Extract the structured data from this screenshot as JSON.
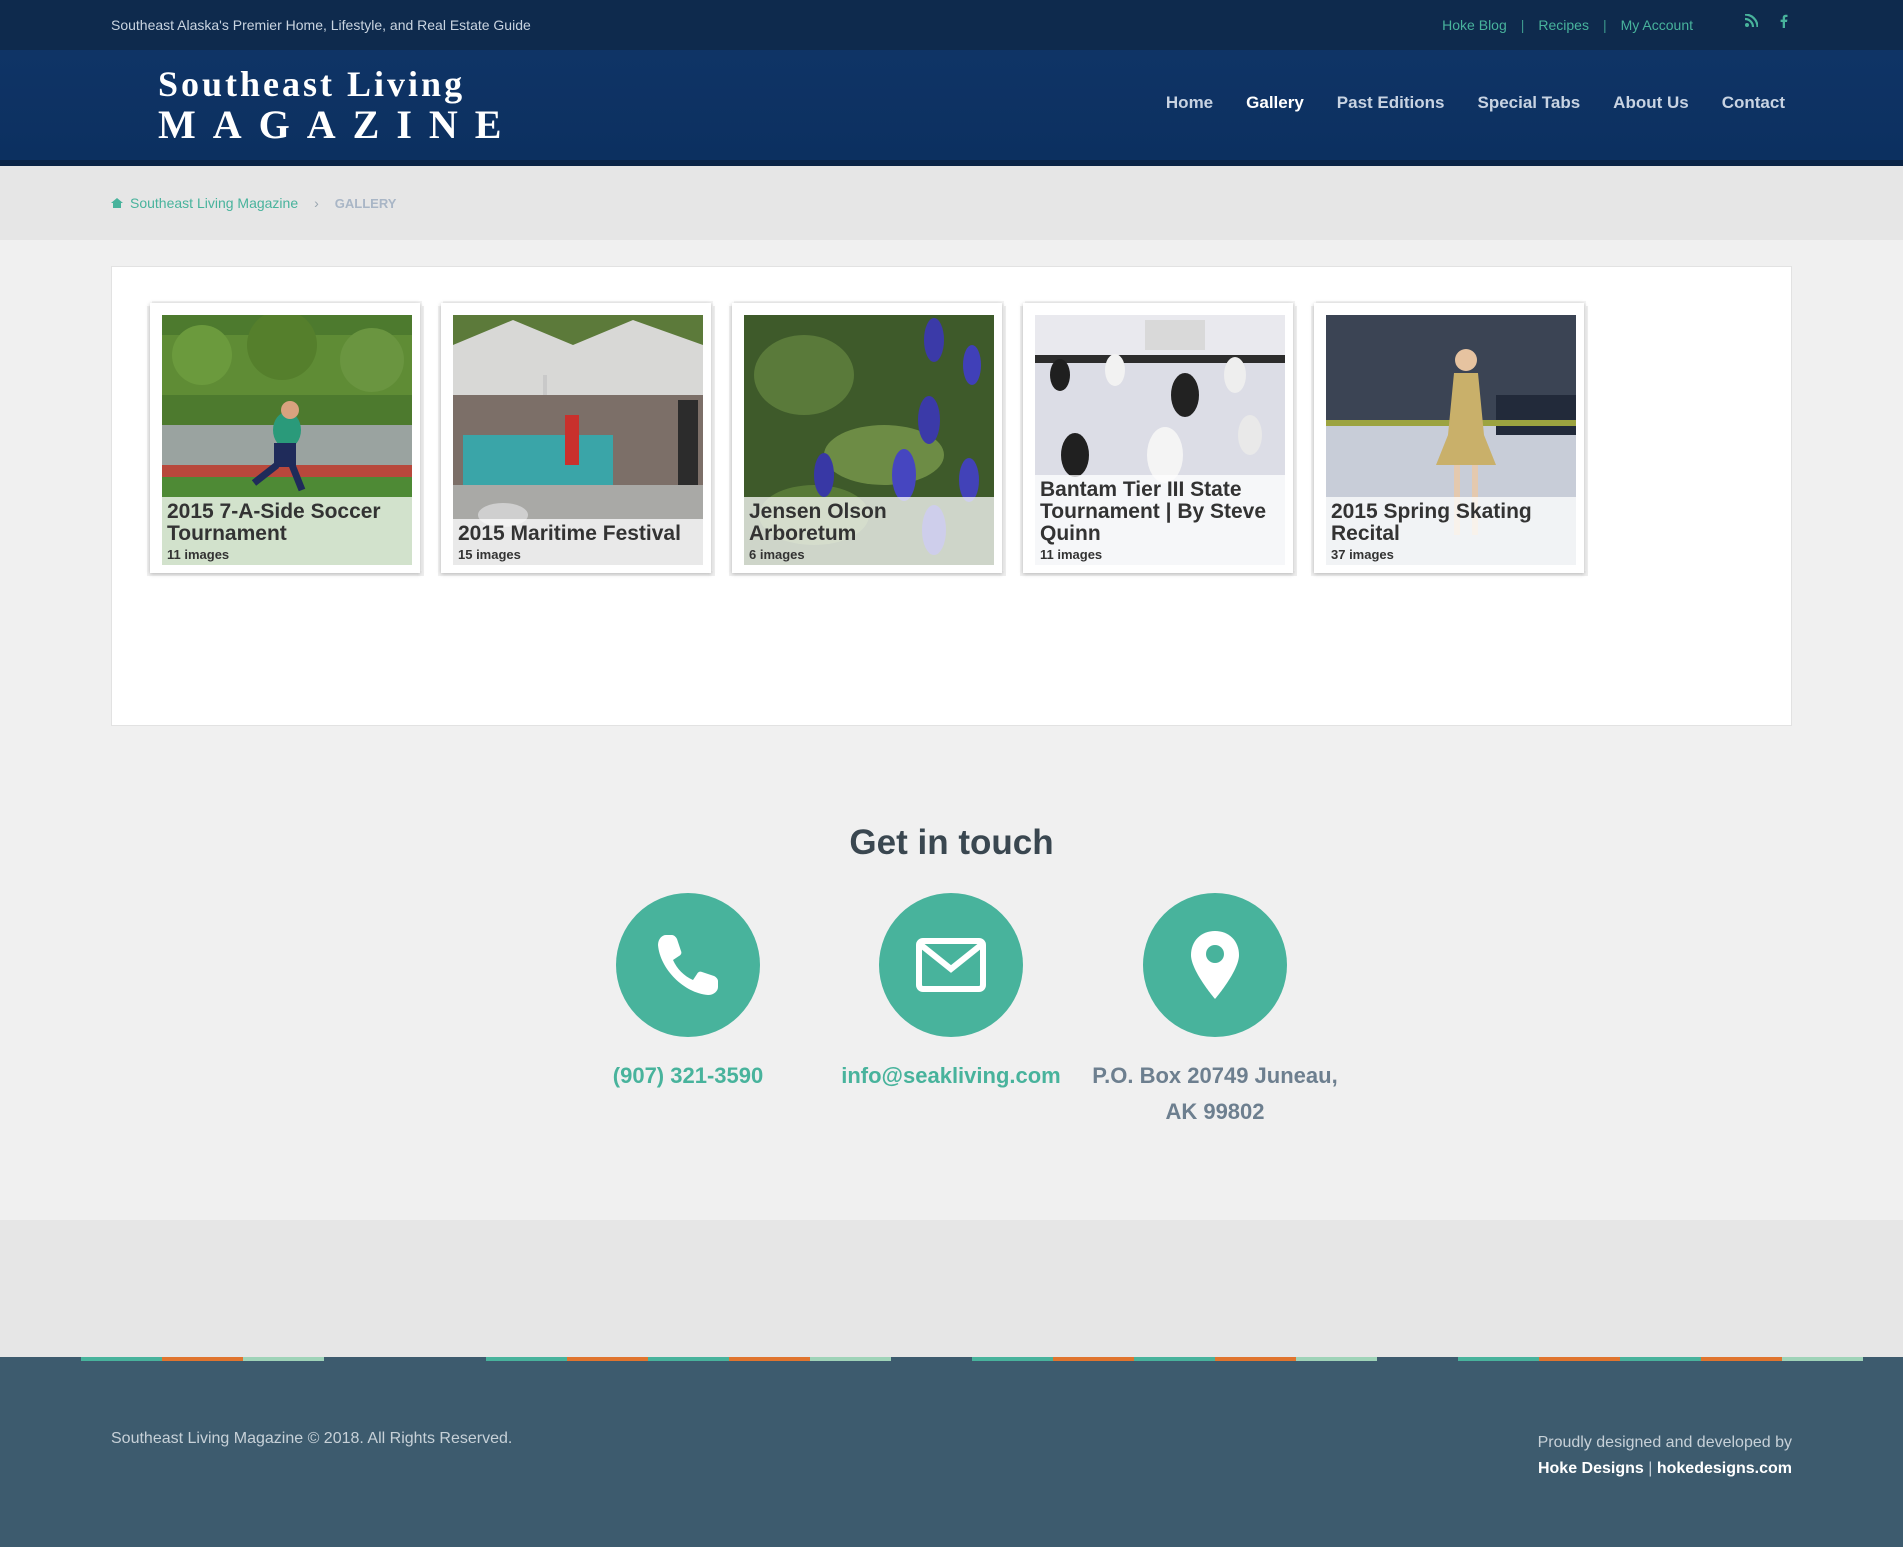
{
  "topbar": {
    "tagline": "Southeast Alaska's Premier Home, Lifestyle, and Real Estate Guide",
    "links": [
      "Hoke Blog",
      "Recipes",
      "My Account"
    ],
    "social_icons": [
      "rss-icon",
      "facebook-icon"
    ]
  },
  "logo": {
    "line1": "Southeast Living",
    "line2": "MAGAZINE"
  },
  "nav": [
    "Home",
    "Gallery",
    "Past Editions",
    "Special Tabs",
    "About Us",
    "Contact"
  ],
  "nav_active": "Gallery",
  "breadcrumb": {
    "home": "Southeast Living Magazine",
    "current": "GALLERY"
  },
  "galleries": [
    {
      "title": "2015 7-A-Side Soccer Tournament",
      "count": "11 images"
    },
    {
      "title": "2015 Maritime Festival",
      "count": "15 images"
    },
    {
      "title": "Jensen Olson Arboretum",
      "count": "6 images"
    },
    {
      "title": "Bantam Tier III State Tournament | By Steve Quinn",
      "count": "11 images"
    },
    {
      "title": "2015 Spring Skating Recital",
      "count": "37 images"
    }
  ],
  "contact": {
    "title": "Get in touch",
    "phone": "(907) 321-3590",
    "email": "info@seakliving.com",
    "address_line1": "P.O. Box 20749 Juneau,",
    "address_line2": "AK 99802"
  },
  "footer": {
    "copyright": "Southeast Living Magazine © 2018. All Rights Reserved.",
    "credit_line": "Proudly designed and developed by",
    "credit_name": "Hoke Designs",
    "credit_sep": "|",
    "credit_site": "hokedesigns.com"
  },
  "colors": {
    "teal": "#48b39c",
    "navy": "#0f3466",
    "footer": "#3d5b6e"
  }
}
